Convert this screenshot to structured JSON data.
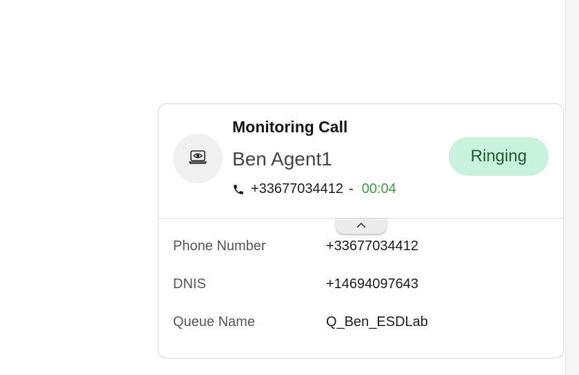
{
  "card": {
    "title": "Monitoring Call",
    "agent_name": "Ben Agent1",
    "phone_number": "+33677034412",
    "separator": "-",
    "timer": "00:04",
    "status": "Ringing",
    "avatar_icon": "monitor-eye-icon",
    "phone_icon": "phone-icon",
    "collapse_icon": "chevron-up-icon"
  },
  "details": [
    {
      "label": "Phone Number",
      "value": "+33677034412"
    },
    {
      "label": "DNIS",
      "value": "+14694097643"
    },
    {
      "label": "Queue Name",
      "value": "Q_Ben_ESDLab"
    }
  ],
  "colors": {
    "status_bg": "#c9f2dc",
    "status_text": "#1c5c2e",
    "timer": "#3a9b3a"
  }
}
